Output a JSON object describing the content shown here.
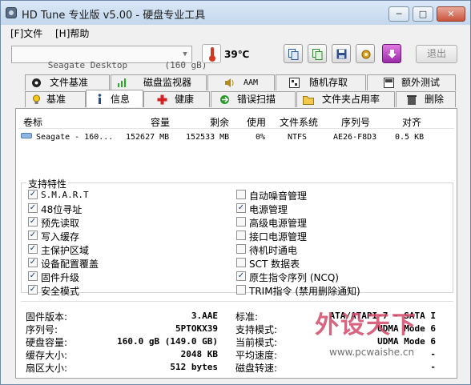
{
  "window": {
    "title": "HD Tune 专业版 v5.00 - 硬盘专业工具",
    "controls": {
      "minimize": "─",
      "maximize": "□",
      "close": "✕"
    }
  },
  "menu": [
    {
      "label": "[F]文件"
    },
    {
      "label": "[H]帮助"
    }
  ],
  "toolbar": {
    "drive_selected": "Seagate Desktop       (160 gB)",
    "temperature": "39℃",
    "exit_label": "退出",
    "buttons": [
      "copy-icon",
      "copy-all-icon",
      "save-icon",
      "settings-icon",
      "download-icon"
    ]
  },
  "tabs": {
    "row1": [
      {
        "label": "文件基准",
        "icon": "file-benchmark-icon"
      },
      {
        "label": "磁盘监视器",
        "icon": "disk-monitor-icon"
      },
      {
        "label": "AAM",
        "icon": "speaker-icon"
      },
      {
        "label": "随机存取",
        "icon": "random-access-icon"
      },
      {
        "label": "额外测试",
        "icon": "extra-tests-icon"
      }
    ],
    "row2": [
      {
        "label": "基准",
        "icon": "bulb-icon"
      },
      {
        "label": "信息",
        "icon": "info-icon",
        "active": true
      },
      {
        "label": "健康",
        "icon": "health-cross-icon"
      },
      {
        "label": "错误扫描",
        "icon": "error-scan-icon"
      },
      {
        "label": "文件夹占用率",
        "icon": "folder-icon"
      },
      {
        "label": "删除",
        "icon": "trash-icon"
      }
    ]
  },
  "partitions": {
    "columns": [
      "卷标",
      "容量",
      "剩余",
      "使用",
      "文件系统",
      "序列号",
      "对齐"
    ],
    "rows": [
      {
        "label": "Seagate - 160...",
        "capacity": "152627 MB",
        "free": "152533 MB",
        "used": "0%",
        "fs": "NTFS",
        "serial": "AE26-F8D3",
        "align": "0.5 KB"
      }
    ]
  },
  "features": {
    "title": "支持特性",
    "left": [
      {
        "label": "S.M.A.R.T",
        "checked": true
      },
      {
        "label": "48位寻址",
        "checked": true
      },
      {
        "label": "预先读取",
        "checked": true
      },
      {
        "label": "写入缓存",
        "checked": true
      },
      {
        "label": "主保护区域",
        "checked": true
      },
      {
        "label": "设备配置覆盖",
        "checked": true
      },
      {
        "label": "固件升级",
        "checked": true
      },
      {
        "label": "安全模式",
        "checked": true
      }
    ],
    "right": [
      {
        "label": "自动噪音管理",
        "checked": false
      },
      {
        "label": "电源管理",
        "checked": true
      },
      {
        "label": "高级电源管理",
        "checked": false
      },
      {
        "label": "接口电源管理",
        "checked": false
      },
      {
        "label": "待机时通电",
        "checked": false
      },
      {
        "label": "SCT 数据表",
        "checked": false
      },
      {
        "label": "原生指令序列 (NCQ)",
        "checked": true
      },
      {
        "label": "TRIM指令 (禁用删除通知)",
        "checked": false
      }
    ]
  },
  "info": {
    "left": [
      {
        "key": "固件版本:",
        "value": "3.AAE"
      },
      {
        "key": "序列号:",
        "value": "5PTOKX39"
      },
      {
        "key": "硬盘容量:",
        "value": "160.0 gB (149.0 GB)"
      },
      {
        "key": "缓存大小:",
        "value": "2048 KB"
      },
      {
        "key": "扇区大小:",
        "value": "512 bytes"
      }
    ],
    "right": [
      {
        "key": "标准:",
        "value": "ATA/ATAPI-7 - SATA I"
      },
      {
        "key": "支持模式:",
        "value": "UDMA Mode 6"
      },
      {
        "key": "当前模式:",
        "value": "UDMA Mode 6"
      },
      {
        "key": "平均速度:",
        "value": "-"
      },
      {
        "key": "磁盘转速:",
        "value": "-"
      }
    ]
  },
  "watermark": {
    "logo": "外设天下",
    "url": "www.pcwaishe.cn"
  }
}
